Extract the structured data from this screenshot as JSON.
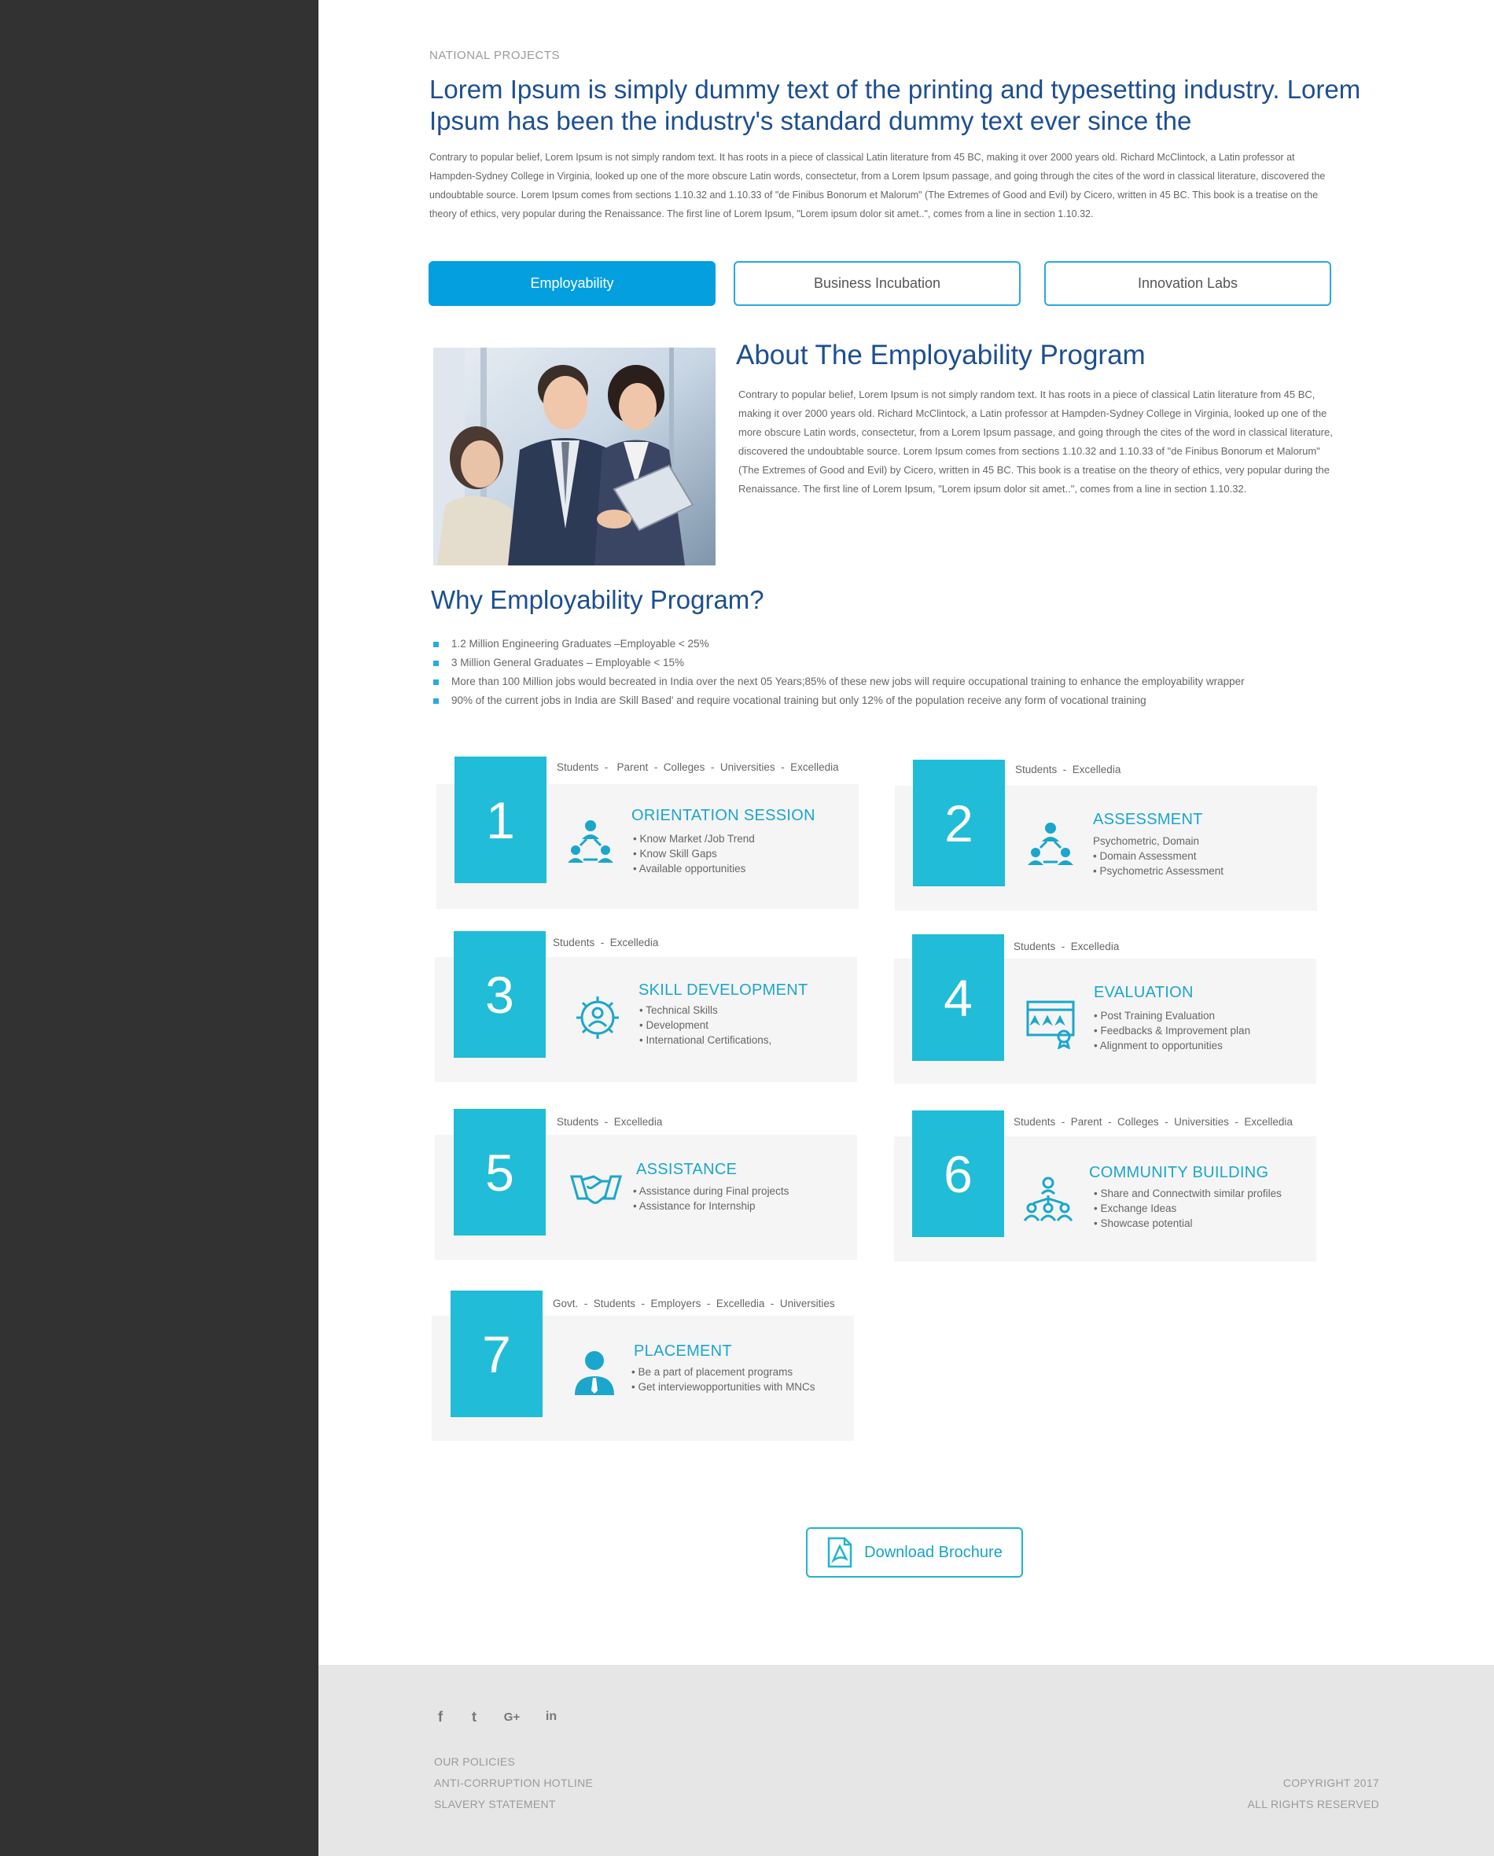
{
  "section": {
    "eyebrow": "NATIONAL PROJECTS",
    "headline": "Lorem Ipsum is simply dummy text of the printing and typesetting industry. Lorem Ipsum has been the industry's standard dummy text ever since the",
    "intro": "Contrary to popular belief, Lorem Ipsum is not simply random text. It has roots in a piece of classical Latin literature from 45 BC, making it over 2000 years old. Richard McClintock, a Latin professor at Hampden-Sydney College in Virginia, looked up one of the more obscure Latin words, consectetur, from a Lorem Ipsum passage, and going through the cites of the word in classical literature, discovered the undoubtable source. Lorem Ipsum comes from sections 1.10.32 and 1.10.33 of \"de Finibus Bonorum et Malorum\" (The Extremes of Good and Evil) by Cicero, written in 45 BC. This book is a treatise on the theory of ethics, very popular during the Renaissance. The first line of Lorem Ipsum, \"Lorem ipsum dolor sit amet..\", comes from a line in section 1.10.32."
  },
  "tabs": [
    {
      "label": "Employability",
      "active": true
    },
    {
      "label": "Business Incubation",
      "active": false
    },
    {
      "label": "Innovation Labs",
      "active": false
    }
  ],
  "about": {
    "title": "About The Employability Program",
    "text": "Contrary to popular belief, Lorem Ipsum is not simply random text. It has roots in a piece of classical Latin literature from 45 BC, making it over 2000 years old. Richard McClintock, a Latin professor at Hampden-Sydney College in Virginia, looked up one of the more obscure Latin words, consectetur, from a Lorem Ipsum passage, and going through the cites of the word in classical literature, discovered the undoubtable source. Lorem Ipsum comes from sections 1.10.32 and 1.10.33 of \"de Finibus Bonorum et Malorum\" (The Extremes of Good and Evil) by Cicero, written in 45 BC. This book is a treatise on the theory of ethics, very popular during the Renaissance. The first line of Lorem Ipsum, \"Lorem ipsum dolor sit amet..\", comes from a line in section 1.10.32."
  },
  "why": {
    "title": "Why Employability Program?",
    "items": [
      "1.2 Million Engineering Graduates –Employable < 25%",
      "3 Million General Graduates – Employable < 15%",
      "More than 100 Million jobs would becreated in India over the next 05 Years;85% of these new jobs will require occupational training to enhance the employability wrapper",
      "90% of the current jobs in India are Skill Based' and require vocational training but only 12% of the population receive any form of vocational training"
    ]
  },
  "steps": [
    {
      "number": "1",
      "who": "Students  -   Parent  -  Colleges  -  Universities  -  Excelledia",
      "title": "ORIENTATION SESSION",
      "icon": "team-network-icon",
      "items": [
        "• Know Market /Job Trend",
        "• Know Skill Gaps",
        "• Available opportunities"
      ]
    },
    {
      "number": "2",
      "who": "Students  -  Excelledia",
      "title": "ASSESSMENT",
      "icon": "team-network-icon",
      "items": [
        "Psychometric, Domain",
        "• Domain Assessment",
        "• Psychometric Assessment"
      ]
    },
    {
      "number": "3",
      "who": "Students  -  Excelledia",
      "title": "SKILL DEVELOPMENT",
      "icon": "gear-person-icon",
      "items": [
        "• Technical Skills",
        "• Development",
        "• International Certifications,"
      ]
    },
    {
      "number": "4",
      "who": "Students  -  Excelledia",
      "title": "EVALUATION",
      "icon": "rating-certificate-icon",
      "items": [
        "• Post Training Evaluation",
        "• Feedbacks & Improvement plan",
        "• Alignment to opportunities"
      ]
    },
    {
      "number": "5",
      "who": "Students  -  Excelledia",
      "title": "ASSISTANCE",
      "icon": "handshake-icon",
      "items": [
        "• Assistance during Final projects",
        "• Assistance for Internship"
      ]
    },
    {
      "number": "6",
      "who": "Students  -  Parent  -  Colleges  -  Universities  -  Excelledia",
      "title": "COMMUNITY BUILDING",
      "icon": "community-network-icon",
      "items": [
        "• Share and Connectwith similar profiles",
        "• Exchange Ideas",
        "• Showcase potential"
      ]
    },
    {
      "number": "7",
      "who": "Govt.  -  Students  -  Employers  -  Excelledia  -  Universities",
      "title": "PLACEMENT",
      "icon": "businessman-icon",
      "items": [
        "• Be a part of placement programs",
        "• Get interviewopportunities with MNCs"
      ]
    }
  ],
  "download": {
    "label": "Download Brochure",
    "icon": "pdf-file-icon"
  },
  "footer": {
    "social": [
      {
        "icon": "facebook-icon",
        "glyph": "f"
      },
      {
        "icon": "twitter-icon",
        "glyph": "t"
      },
      {
        "icon": "google-plus-icon",
        "glyph": "G+"
      },
      {
        "icon": "linkedin-icon",
        "glyph": "in"
      }
    ],
    "links": [
      "OUR POLICIES",
      "ANTI-CORRUPTION HOTLINE",
      "SLAVERY STATEMENT"
    ],
    "copyright": "COPYRIGHT 2017",
    "rights": "ALL RIGHTS RESERVED"
  },
  "colors": {
    "sidebar": "#323232",
    "accent": "#039fdf",
    "number_box": "#21bcd7",
    "heading": "#1d4f91",
    "footer": "#e6e6e6"
  }
}
